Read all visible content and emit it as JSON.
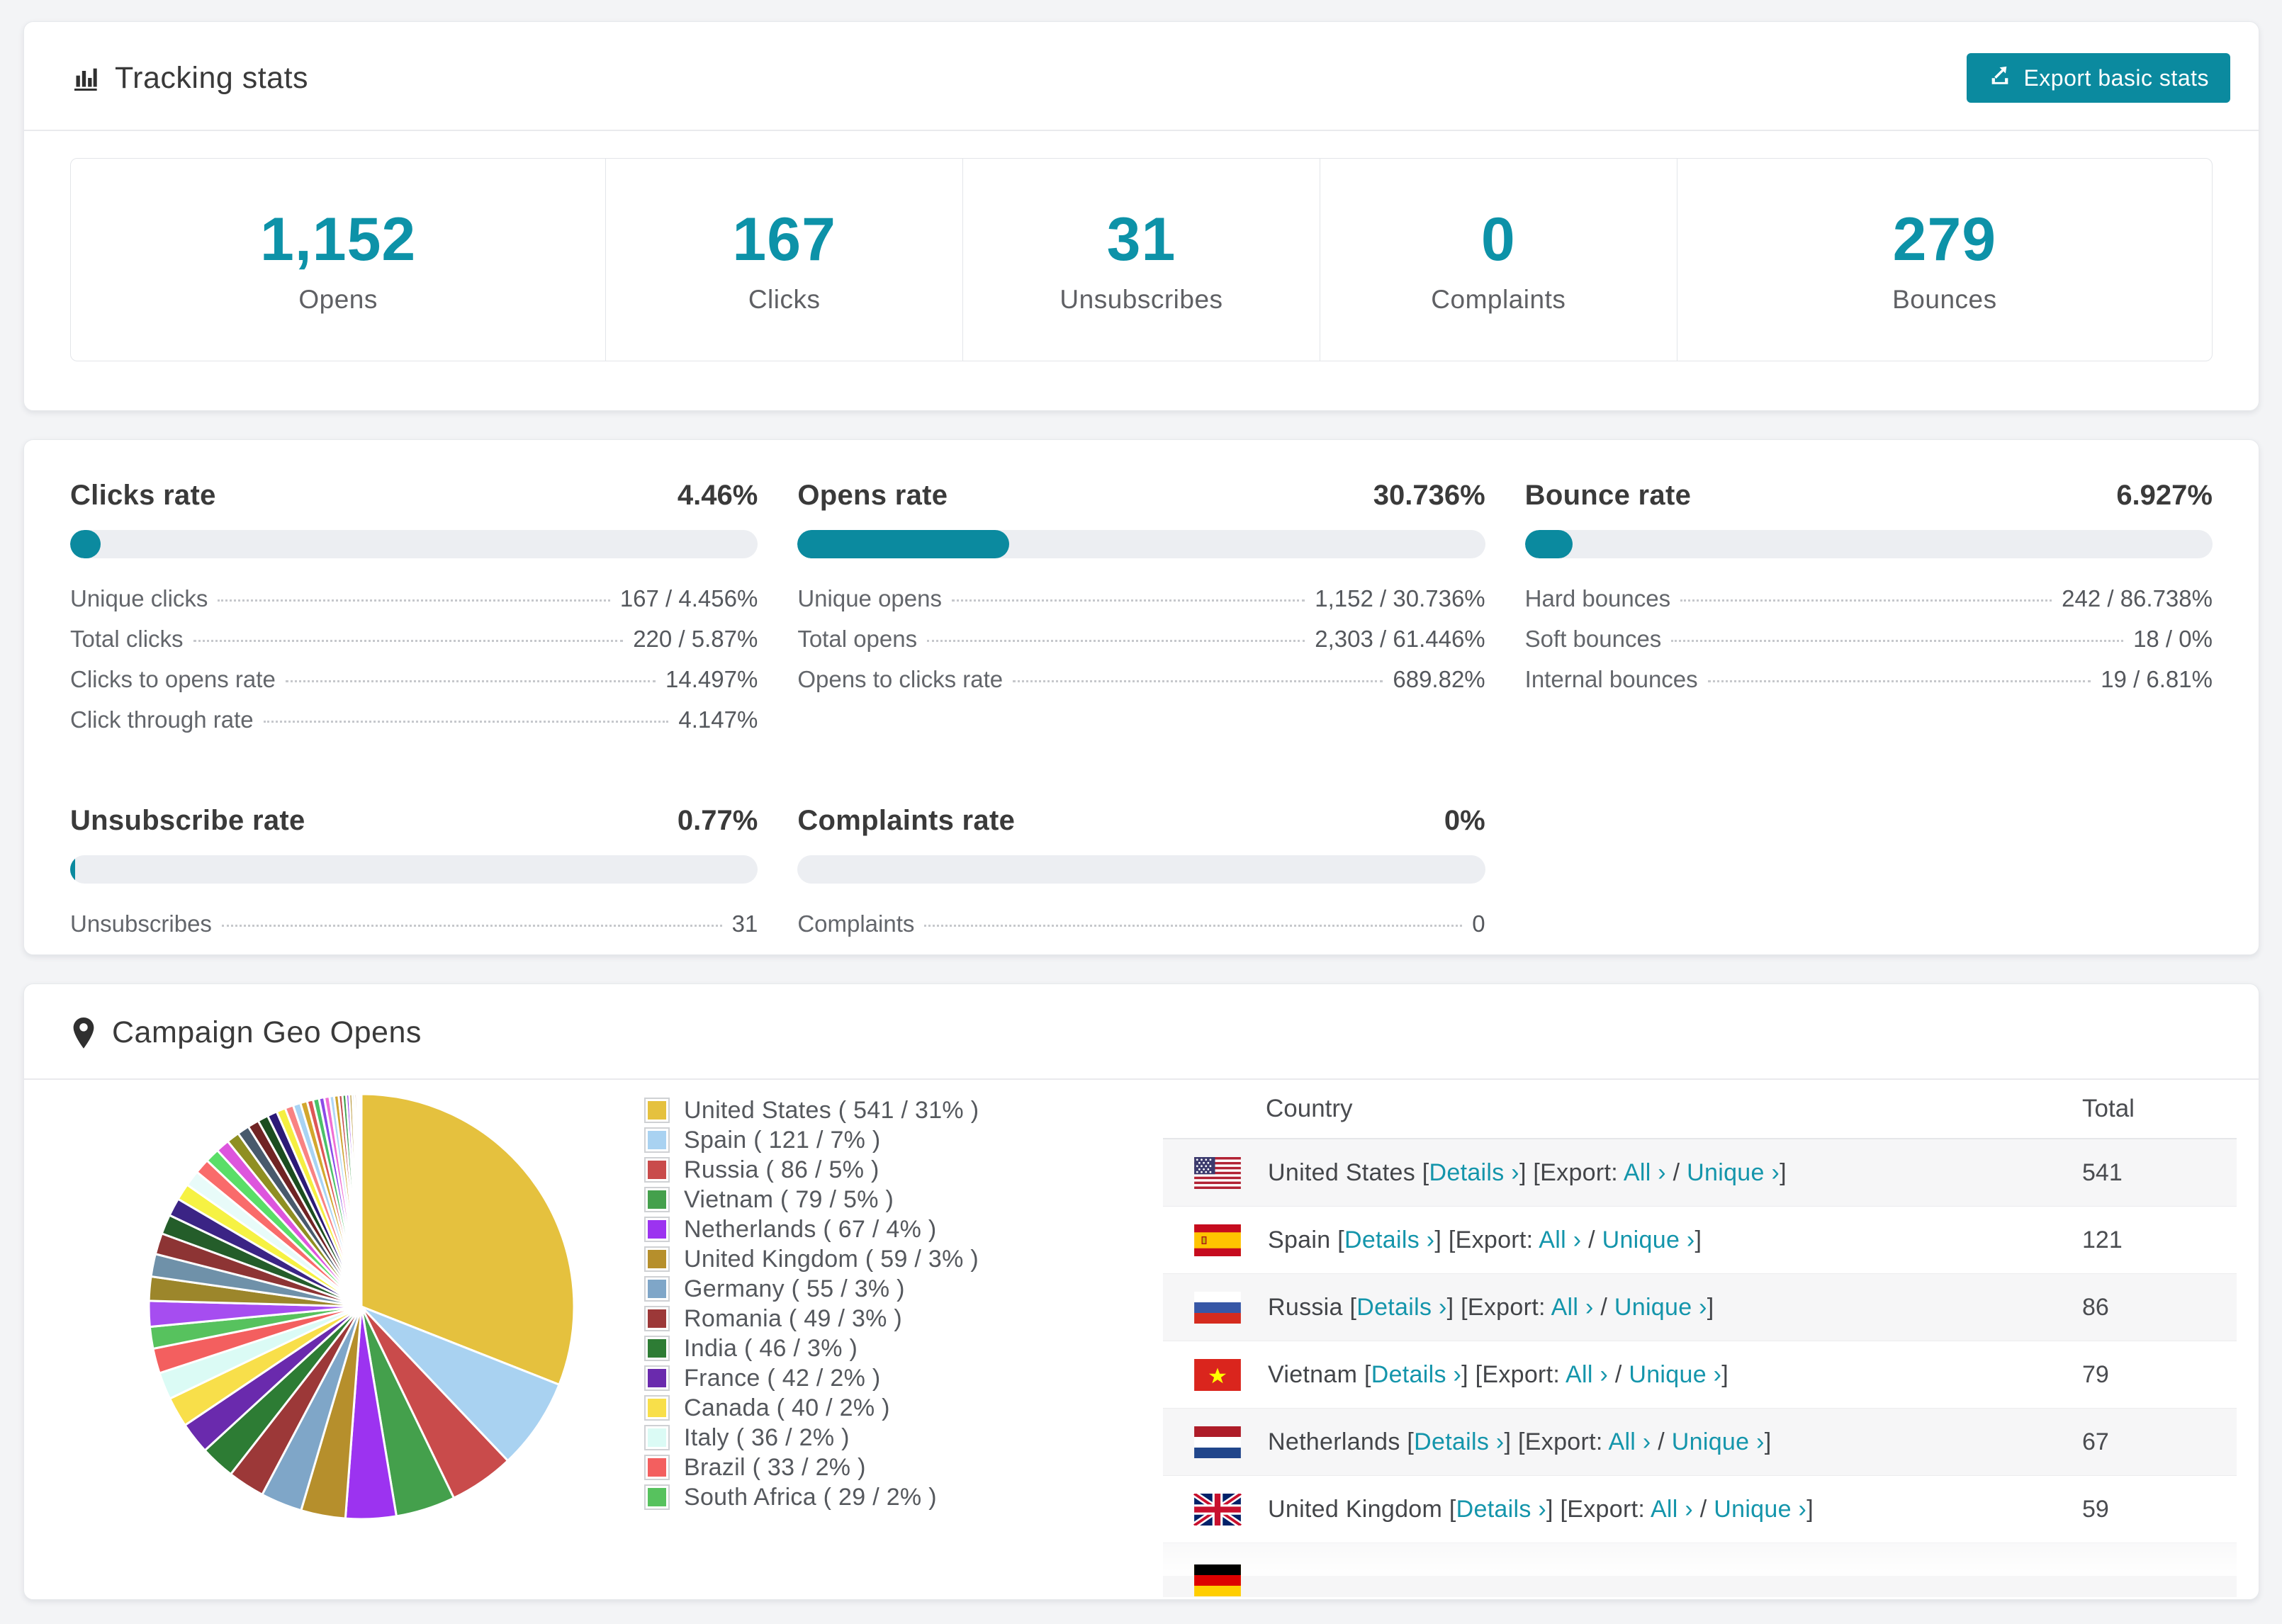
{
  "colors": {
    "accent": "#0b8a9f",
    "number": "#0d92a8",
    "link": "#1495ab"
  },
  "tracking": {
    "title": "Tracking stats",
    "export_button": "Export basic stats",
    "summary": [
      {
        "value": "1,152",
        "label": "Opens"
      },
      {
        "value": "167",
        "label": "Clicks"
      },
      {
        "value": "31",
        "label": "Unsubscribes"
      },
      {
        "value": "0",
        "label": "Complaints"
      },
      {
        "value": "279",
        "label": "Bounces"
      }
    ]
  },
  "rates": [
    {
      "title": "Clicks rate",
      "value": "4.46%",
      "percent": 4.46,
      "rows": [
        [
          "Unique clicks",
          "167 / 4.456%"
        ],
        [
          "Total clicks",
          "220 / 5.87%"
        ],
        [
          "Clicks to opens rate",
          "14.497%"
        ],
        [
          "Click through rate",
          "4.147%"
        ]
      ]
    },
    {
      "title": "Opens rate",
      "value": "30.736%",
      "percent": 30.736,
      "rows": [
        [
          "Unique opens",
          "1,152 / 30.736%"
        ],
        [
          "Total opens",
          "2,303 / 61.446%"
        ],
        [
          "Opens to clicks rate",
          "689.82%"
        ]
      ]
    },
    {
      "title": "Bounce rate",
      "value": "6.927%",
      "percent": 6.927,
      "rows": [
        [
          "Hard bounces",
          "242 / 86.738%"
        ],
        [
          "Soft bounces",
          "18 / 0%"
        ],
        [
          "Internal bounces",
          "19 / 6.81%"
        ]
      ]
    },
    {
      "title": "Unsubscribe rate",
      "value": "0.77%",
      "percent": 0.77,
      "rows": [
        [
          "Unsubscribes",
          "31"
        ]
      ]
    },
    {
      "title": "Complaints rate",
      "value": "0%",
      "percent": 0,
      "rows": [
        [
          "Complaints",
          "0"
        ]
      ]
    }
  ],
  "geo": {
    "title": "Campaign Geo Opens",
    "table": {
      "col_country": "Country",
      "col_total": "Total",
      "bracket1": " [",
      "details_label": "Details ›",
      "bracket2": "] [Export: ",
      "all_label": "All ›",
      "slash": " / ",
      "unique_label": "Unique ›",
      "bracket3": "]",
      "rows": [
        {
          "flag": "us",
          "country": "United States",
          "total": "541"
        },
        {
          "flag": "es",
          "country": "Spain",
          "total": "121"
        },
        {
          "flag": "ru",
          "country": "Russia",
          "total": "86"
        },
        {
          "flag": "vn",
          "country": "Vietnam",
          "total": "79"
        },
        {
          "flag": "nl",
          "country": "Netherlands",
          "total": "67"
        },
        {
          "flag": "gb",
          "country": "United Kingdom",
          "total": "59"
        },
        {
          "flag": "de",
          "country": "",
          "total": ""
        }
      ]
    }
  },
  "chart_data": {
    "type": "pie",
    "title": "Campaign Geo Opens",
    "legend_position": "right",
    "start_angle_deg": -90,
    "direction": "clockwise",
    "slices": [
      {
        "label": "United States",
        "value": 541,
        "pct": "31%",
        "color": "#e5c13e"
      },
      {
        "label": "Spain",
        "value": 121,
        "pct": "7%",
        "color": "#a9d2f1"
      },
      {
        "label": "Russia",
        "value": 86,
        "pct": "5%",
        "color": "#c94b4b"
      },
      {
        "label": "Vietnam",
        "value": 79,
        "pct": "5%",
        "color": "#44a04c"
      },
      {
        "label": "Netherlands",
        "value": 67,
        "pct": "4%",
        "color": "#9c33f0"
      },
      {
        "label": "United Kingdom",
        "value": 59,
        "pct": "3%",
        "color": "#b68f2c"
      },
      {
        "label": "Germany",
        "value": 55,
        "pct": "3%",
        "color": "#7fa6c8"
      },
      {
        "label": "Romania",
        "value": 49,
        "pct": "3%",
        "color": "#9c3838"
      },
      {
        "label": "India",
        "value": 46,
        "pct": "3%",
        "color": "#2d7c34"
      },
      {
        "label": "France",
        "value": 42,
        "pct": "2%",
        "color": "#6a2aad"
      },
      {
        "label": "Canada",
        "value": 40,
        "pct": "2%",
        "color": "#f8df4a"
      },
      {
        "label": "Italy",
        "value": 36,
        "pct": "2%",
        "color": "#dbfbf5"
      },
      {
        "label": "Brazil",
        "value": 33,
        "pct": "2%",
        "color": "#f35f5f"
      },
      {
        "label": "South Africa",
        "value": 29,
        "pct": "2%",
        "color": "#57c25e"
      },
      {
        "label": "other",
        "value": 34,
        "color": "#a64df0"
      },
      {
        "label": "other",
        "value": 32,
        "color": "#9c862b"
      },
      {
        "label": "other",
        "value": 30,
        "color": "#6f91a9"
      },
      {
        "label": "other",
        "value": 28,
        "color": "#8d3434"
      },
      {
        "label": "other",
        "value": 26,
        "color": "#245d2a"
      },
      {
        "label": "other",
        "value": 24,
        "color": "#3b2485"
      },
      {
        "label": "other",
        "value": 22,
        "color": "#f6f243"
      },
      {
        "label": "other",
        "value": 21,
        "color": "#e8fbf9"
      },
      {
        "label": "other",
        "value": 20,
        "color": "#f96b6b"
      },
      {
        "label": "other",
        "value": 19,
        "color": "#5ade68"
      },
      {
        "label": "other",
        "value": 18,
        "color": "#dd55dd"
      },
      {
        "label": "other",
        "value": 17,
        "color": "#8f8f22"
      },
      {
        "label": "other",
        "value": 16,
        "color": "#485a6c"
      },
      {
        "label": "other",
        "value": 15,
        "color": "#702424"
      },
      {
        "label": "other",
        "value": 14,
        "color": "#1b4d20"
      },
      {
        "label": "other",
        "value": 13,
        "color": "#2c1a77"
      },
      {
        "label": "other",
        "value": 12,
        "color": "#f5ef41"
      },
      {
        "label": "other",
        "value": 11,
        "color": "#f98282"
      },
      {
        "label": "other",
        "value": 10,
        "color": "#a8d3f3"
      },
      {
        "label": "other",
        "value": 9,
        "color": "#d3a72e"
      },
      {
        "label": "other",
        "value": 8,
        "color": "#de5656"
      },
      {
        "label": "other",
        "value": 8,
        "color": "#4bc169"
      },
      {
        "label": "other",
        "value": 7,
        "color": "#8b4be7"
      },
      {
        "label": "other",
        "value": 7,
        "color": "#ef6ed4"
      },
      {
        "label": "other",
        "value": 6,
        "color": "#b0d7f5"
      },
      {
        "label": "other",
        "value": 6,
        "color": "#cfa42f"
      },
      {
        "label": "other",
        "value": 5,
        "color": "#c34e4e"
      },
      {
        "label": "other",
        "value": 5,
        "color": "#3fa04f"
      },
      {
        "label": "other",
        "value": 4,
        "color": "#9439ec"
      },
      {
        "label": "other",
        "value": 4,
        "color": "#b5922f"
      },
      {
        "label": "other",
        "value": 3,
        "color": "#86abcc"
      },
      {
        "label": "other",
        "value": 3,
        "color": "#a03b3b"
      },
      {
        "label": "other",
        "value": 2,
        "color": "#317f38"
      },
      {
        "label": "other",
        "value": 2,
        "color": "#7030b2"
      },
      {
        "label": "other",
        "value": 1,
        "color": "#f9e14e"
      },
      {
        "label": "other",
        "value": 1,
        "color": "#e2fbf6"
      }
    ]
  }
}
